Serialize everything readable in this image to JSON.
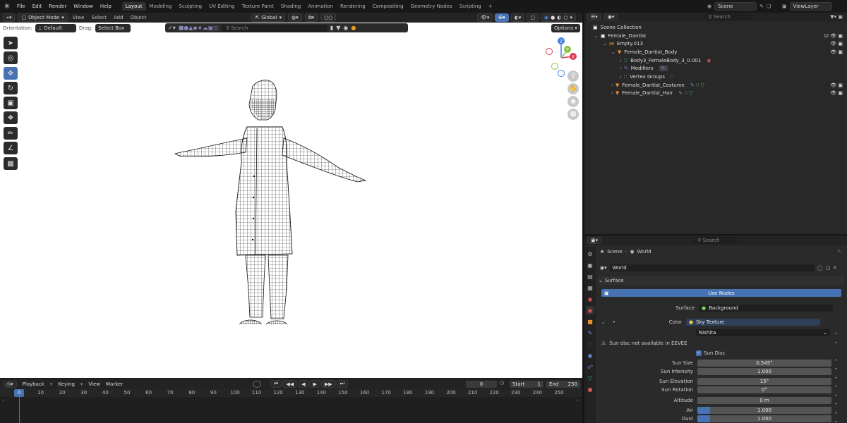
{
  "topbar": {
    "menus": [
      "File",
      "Edit",
      "Render",
      "Window",
      "Help"
    ],
    "workspaces": [
      "Layout",
      "Modeling",
      "Sculpting",
      "UV Editing",
      "Texture Paint",
      "Shading",
      "Animation",
      "Rendering",
      "Compositing",
      "Geometry Nodes",
      "Scripting"
    ],
    "active_workspace": "Layout",
    "add_tab": "+",
    "scene_label": "Scene",
    "view_layer_label": "ViewLayer"
  },
  "viewport_header": {
    "mode": "Object Mode",
    "menus": [
      "View",
      "Select",
      "Add",
      "Object"
    ],
    "transform_orientation": "Global",
    "orientation_label": "Orientation:",
    "orientation_value": "Default",
    "drag_label": "Drag:",
    "drag_value": "Select Box",
    "search_placeholder": "Search",
    "options_label": "Options"
  },
  "gizmo": {
    "x": "X",
    "y": "Y",
    "z": "Z"
  },
  "outliner": {
    "search_placeholder": "Search",
    "rows": [
      {
        "label": "Scene Collection"
      },
      {
        "label": "Female_Dantist"
      },
      {
        "label": "Empty.013"
      },
      {
        "label": "Female_Dantist_Body"
      },
      {
        "label": "Body3_FemaleBody_3_0.001"
      },
      {
        "label": "Modifiers"
      },
      {
        "label": "Vertex Groups"
      },
      {
        "label": "Female_Dantist_Costume"
      },
      {
        "label": "Female_Dantist_Hair"
      }
    ]
  },
  "properties": {
    "search_placeholder": "Search",
    "breadcrumb_scene": "Scene",
    "breadcrumb_world": "World",
    "world_name": "World",
    "surface_panel": "Surface",
    "use_nodes": "Use Nodes",
    "surface_label": "Surface",
    "surface_value": "Background",
    "color_label": "Color",
    "color_value": "Sky Texture",
    "sky_type": "Nishita",
    "warning": "Sun disc not available in EEVEE",
    "sun_disc_label": "Sun Disc",
    "sun_size_label": "Sun Size",
    "sun_size_value": "0.545°",
    "sun_intensity_label": "Sun Intensity",
    "sun_intensity_value": "1.000",
    "sun_elevation_label": "Sun Elevation",
    "sun_elevation_value": "15°",
    "sun_rotation_label": "Sun Rotation",
    "sun_rotation_value": "0°",
    "altitude_label": "Altitude",
    "altitude_value": "0 m",
    "air_label": "Air",
    "air_value": "1.000",
    "dust_label": "Dust",
    "dust_value": "1.000"
  },
  "timeline": {
    "menus": [
      "Playback",
      "Keying",
      "View",
      "Marker"
    ],
    "current_frame": "0",
    "start_label": "Start",
    "start_value": "1",
    "end_label": "End",
    "end_value": "250",
    "ruler_ticks": [
      "0",
      "10",
      "20",
      "30",
      "40",
      "50",
      "60",
      "70",
      "80",
      "90",
      "100",
      "110",
      "120",
      "130",
      "140",
      "150",
      "160",
      "170",
      "180",
      "190",
      "200",
      "210",
      "220",
      "230",
      "240",
      "250"
    ]
  },
  "colors": {
    "accent": "#4772b3",
    "x_axis": "#e23a4e",
    "y_axis": "#8bc34a",
    "z_axis": "#3f82e0",
    "warning_bg": "#2a2a2a"
  }
}
